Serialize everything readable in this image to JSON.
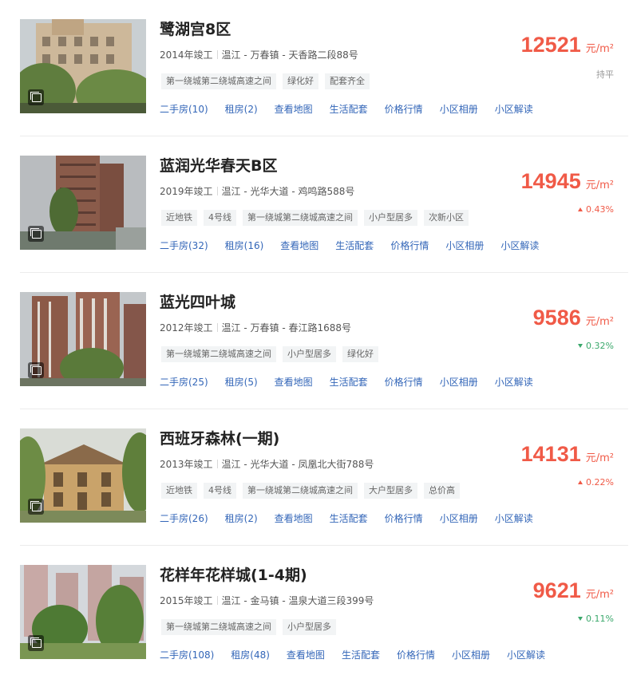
{
  "colors": {
    "price": "#f05a47",
    "link": "#3366b8",
    "up": "#f05a47",
    "down": "#3aa86b",
    "flat": "#999999"
  },
  "communities": [
    {
      "name": "鹭湖宫8区",
      "year": "2014年竣工",
      "location": "温江 - 万春镇 - 天香路二段88号",
      "tags": [
        "第一绕城第二绕城高速之间",
        "绿化好",
        "配套齐全"
      ],
      "links": [
        "二手房(10)",
        "租房(2)",
        "查看地图",
        "生活配套",
        "价格行情",
        "小区相册",
        "小区解读"
      ],
      "price": "12521",
      "unit": "元/m²",
      "change": "持平",
      "trend": "flat"
    },
    {
      "name": "蓝润光华春天B区",
      "year": "2019年竣工",
      "location": "温江 - 光华大道 - 鸡鸣路588号",
      "tags": [
        "近地铁",
        "4号线",
        "第一绕城第二绕城高速之间",
        "小户型居多",
        "次新小区"
      ],
      "links": [
        "二手房(32)",
        "租房(16)",
        "查看地图",
        "生活配套",
        "价格行情",
        "小区相册",
        "小区解读"
      ],
      "price": "14945",
      "unit": "元/m²",
      "change": "0.43%",
      "trend": "up"
    },
    {
      "name": "蓝光四叶城",
      "year": "2012年竣工",
      "location": "温江 - 万春镇 - 春江路1688号",
      "tags": [
        "第一绕城第二绕城高速之间",
        "小户型居多",
        "绿化好"
      ],
      "links": [
        "二手房(25)",
        "租房(5)",
        "查看地图",
        "生活配套",
        "价格行情",
        "小区相册",
        "小区解读"
      ],
      "price": "9586",
      "unit": "元/m²",
      "change": "0.32%",
      "trend": "down"
    },
    {
      "name": "西班牙森林(一期)",
      "year": "2013年竣工",
      "location": "温江 - 光华大道 - 凤凰北大街788号",
      "tags": [
        "近地铁",
        "4号线",
        "第一绕城第二绕城高速之间",
        "大户型居多",
        "总价高"
      ],
      "links": [
        "二手房(26)",
        "租房(2)",
        "查看地图",
        "生活配套",
        "价格行情",
        "小区相册",
        "小区解读"
      ],
      "price": "14131",
      "unit": "元/m²",
      "change": "0.22%",
      "trend": "up"
    },
    {
      "name": "花样年花样城(1-4期)",
      "year": "2015年竣工",
      "location": "温江 - 金马镇 - 温泉大道三段399号",
      "tags": [
        "第一绕城第二绕城高速之间",
        "小户型居多"
      ],
      "links": [
        "二手房(108)",
        "租房(48)",
        "查看地图",
        "生活配套",
        "价格行情",
        "小区相册",
        "小区解读"
      ],
      "price": "9621",
      "unit": "元/m²",
      "change": "0.11%",
      "trend": "down"
    }
  ]
}
